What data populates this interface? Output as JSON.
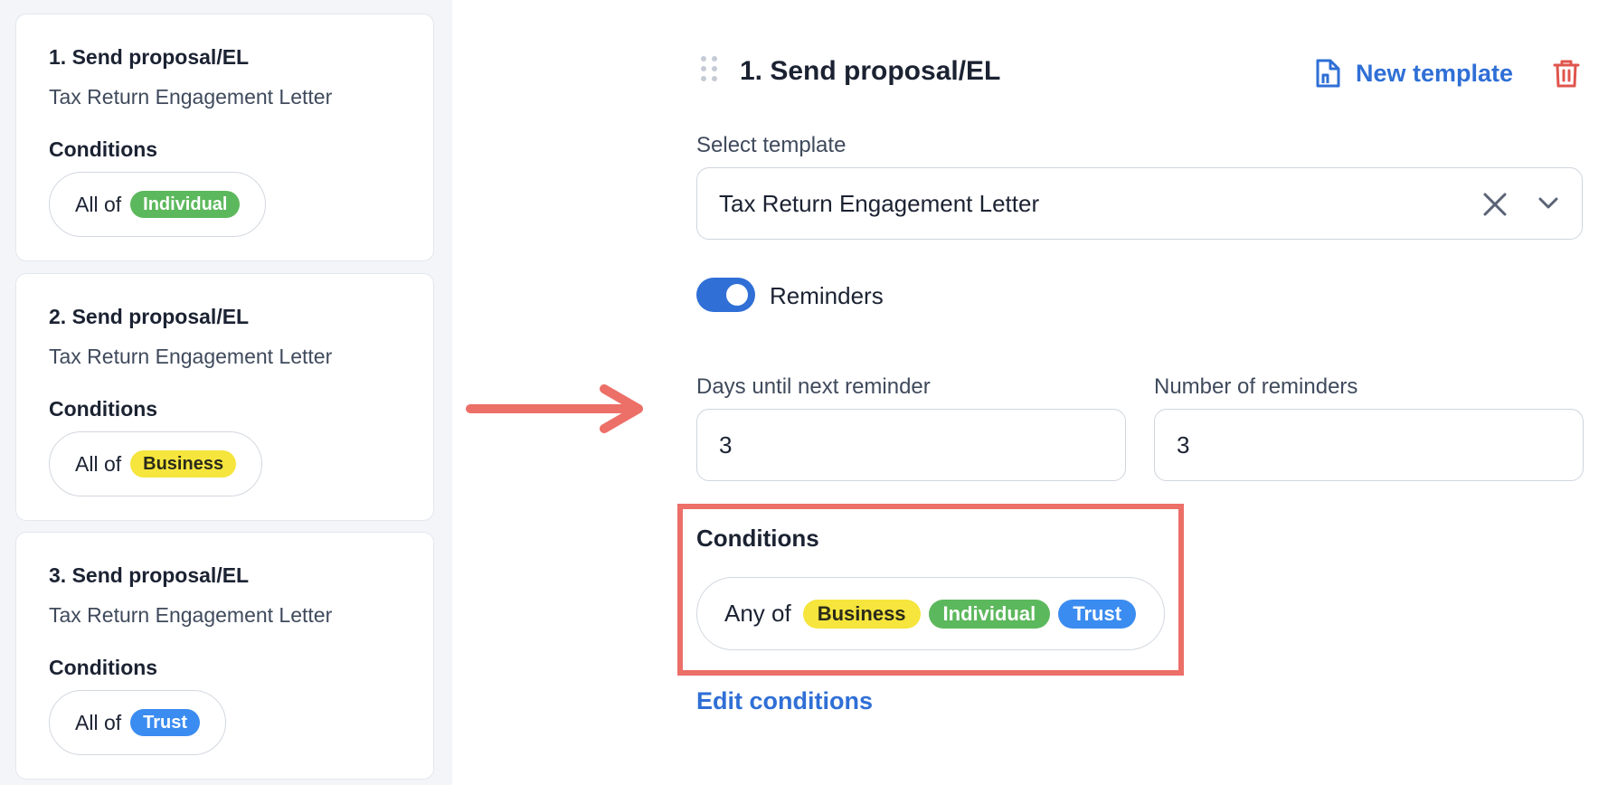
{
  "sidebar": {
    "cards": [
      {
        "title": "1. Send proposal/EL",
        "subtitle": "Tax Return Engagement Letter",
        "conditions_label": "Conditions",
        "conditions_prefix": "All of",
        "tags": [
          {
            "label": "Individual",
            "color": "#5cb85c"
          }
        ]
      },
      {
        "title": "2. Send proposal/EL",
        "subtitle": "Tax Return Engagement Letter",
        "conditions_label": "Conditions",
        "conditions_prefix": "All of",
        "tags": [
          {
            "label": "Business",
            "color": "#f5e53d"
          }
        ]
      },
      {
        "title": "3. Send proposal/EL",
        "subtitle": "Tax Return Engagement Letter",
        "conditions_label": "Conditions",
        "conditions_prefix": "All of",
        "tags": [
          {
            "label": "Trust",
            "color": "#3b8cf0"
          }
        ]
      }
    ]
  },
  "editor": {
    "title": "1. Send proposal/EL",
    "new_template_label": "New template",
    "template": {
      "label": "Select template",
      "value": "Tax Return Engagement Letter"
    },
    "reminders": {
      "label": "Reminders",
      "enabled": true
    },
    "days_until_next": {
      "label": "Days until next reminder",
      "value": "3"
    },
    "number_of_reminders": {
      "label": "Number of reminders",
      "value": "3"
    },
    "conditions": {
      "label": "Conditions",
      "prefix": "Any of",
      "tags": [
        {
          "label": "Business",
          "color": "#f5e53d"
        },
        {
          "label": "Individual",
          "color": "#5cb85c"
        },
        {
          "label": "Trust",
          "color": "#3b8cf0"
        }
      ]
    },
    "edit_conditions_label": "Edit conditions"
  },
  "colors": {
    "accent": "#2f6fd6",
    "danger": "#e0554d",
    "highlight": "#ec6f68",
    "arrow": "#ec6f68"
  },
  "icons": [
    "drag-handle-icon",
    "file-plus-icon",
    "trash-icon",
    "clear-icon",
    "chevron-down-icon",
    "arrow-right-icon"
  ]
}
